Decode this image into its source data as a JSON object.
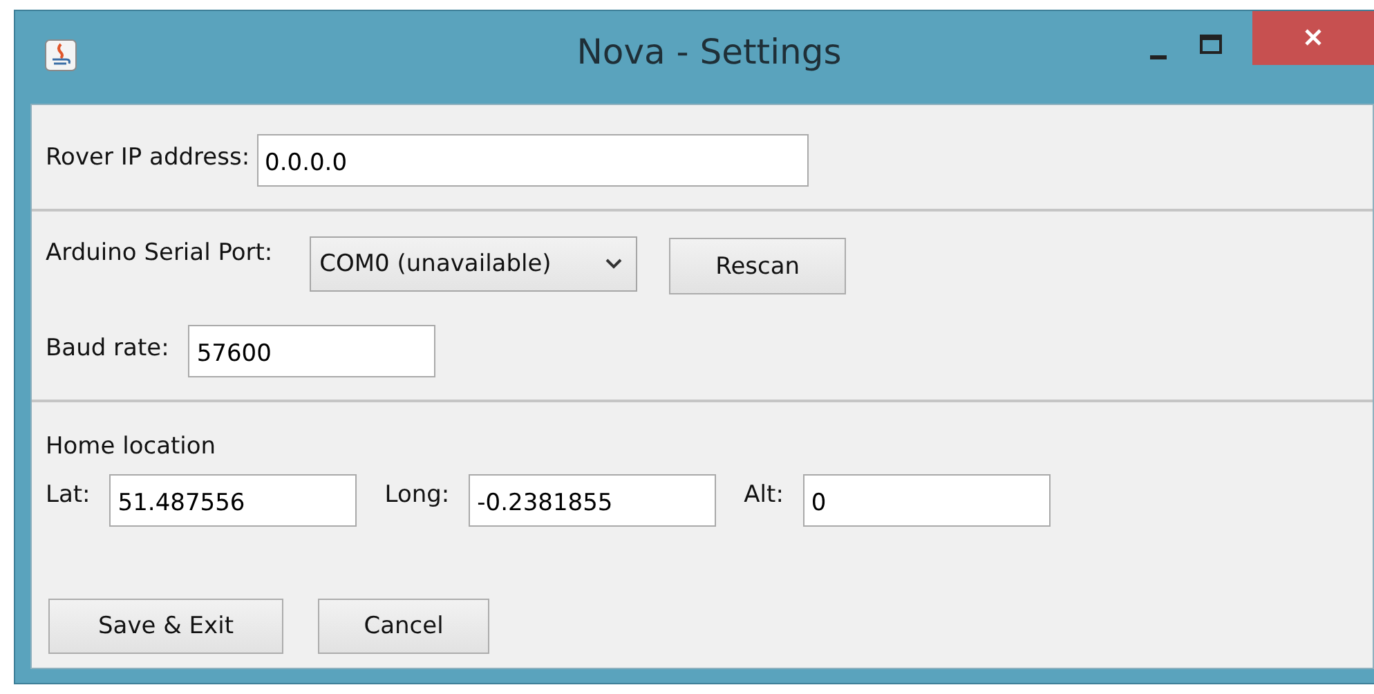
{
  "window": {
    "title": "Nova - Settings"
  },
  "rover": {
    "label": "Rover IP address:",
    "value": "0.0.0.0"
  },
  "serial": {
    "label": "Arduino Serial Port:",
    "port": "COM0 (unavailable)",
    "rescan": "Rescan",
    "baud_label": "Baud rate:",
    "baud": "57600"
  },
  "home": {
    "heading": "Home location",
    "fields": [
      {
        "label": "Lat:",
        "value": "51.487556"
      },
      {
        "label": "Long:",
        "value": "-0.2381855"
      },
      {
        "label": "Alt:",
        "value": "0"
      }
    ]
  },
  "buttons": [
    "Save & Exit",
    "Cancel"
  ]
}
